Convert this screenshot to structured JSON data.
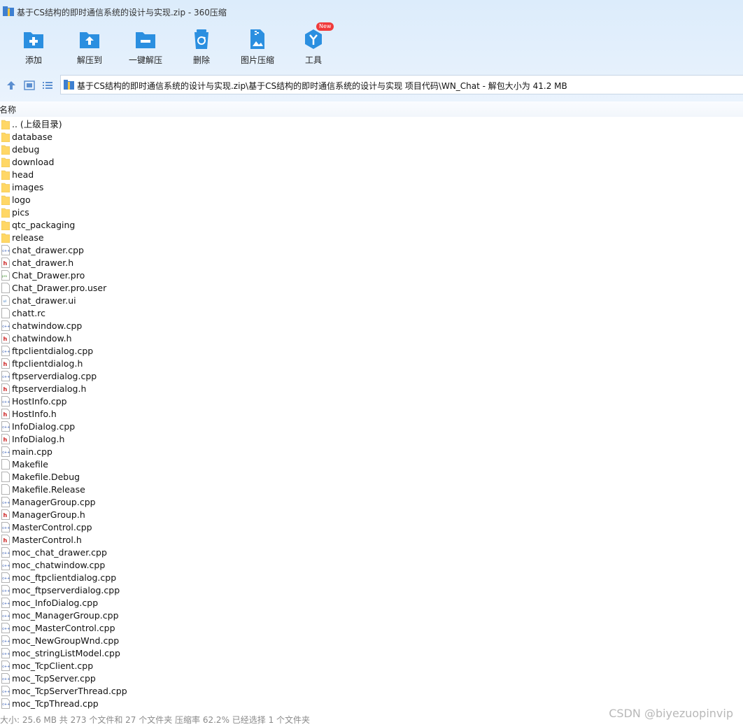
{
  "window": {
    "title": "基于CS结构的即时通信系统的设计与实现.zip - 360压缩"
  },
  "toolbar": {
    "buttons": [
      {
        "label": "添加",
        "icon": "add-icon"
      },
      {
        "label": "解压到",
        "icon": "extract-to-icon"
      },
      {
        "label": "一键解压",
        "icon": "one-click-extract-icon"
      },
      {
        "label": "删除",
        "icon": "delete-icon"
      },
      {
        "label": "图片压缩",
        "icon": "image-compress-icon"
      },
      {
        "label": "工具",
        "icon": "tools-icon",
        "badge": "New"
      }
    ]
  },
  "address": {
    "path": "基于CS结构的即时通信系统的设计与实现.zip\\基于CS结构的即时通信系统的设计与实现 项目代码\\WN_Chat - 解包大小为 41.2 MB"
  },
  "columns": {
    "name": "名称"
  },
  "files": [
    {
      "name": ".. (上级目录)",
      "type": "folder"
    },
    {
      "name": "database",
      "type": "folder"
    },
    {
      "name": "debug",
      "type": "folder"
    },
    {
      "name": "download",
      "type": "folder"
    },
    {
      "name": "head",
      "type": "folder"
    },
    {
      "name": "images",
      "type": "folder"
    },
    {
      "name": "logo",
      "type": "folder"
    },
    {
      "name": "pics",
      "type": "folder"
    },
    {
      "name": "qtc_packaging",
      "type": "folder"
    },
    {
      "name": "release",
      "type": "folder"
    },
    {
      "name": "chat_drawer.cpp",
      "type": "cpp"
    },
    {
      "name": "chat_drawer.h",
      "type": "h"
    },
    {
      "name": "Chat_Drawer.pro",
      "type": "pro"
    },
    {
      "name": "Chat_Drawer.pro.user",
      "type": "file"
    },
    {
      "name": "chat_drawer.ui",
      "type": "ui"
    },
    {
      "name": "chatt.rc",
      "type": "file"
    },
    {
      "name": "chatwindow.cpp",
      "type": "cpp"
    },
    {
      "name": "chatwindow.h",
      "type": "h"
    },
    {
      "name": "ftpclientdialog.cpp",
      "type": "cpp"
    },
    {
      "name": "ftpclientdialog.h",
      "type": "h"
    },
    {
      "name": "ftpserverdialog.cpp",
      "type": "cpp"
    },
    {
      "name": "ftpserverdialog.h",
      "type": "h"
    },
    {
      "name": "HostInfo.cpp",
      "type": "cpp"
    },
    {
      "name": "HostInfo.h",
      "type": "h"
    },
    {
      "name": "InfoDialog.cpp",
      "type": "cpp"
    },
    {
      "name": "InfoDialog.h",
      "type": "h"
    },
    {
      "name": "main.cpp",
      "type": "cpp"
    },
    {
      "name": "Makefile",
      "type": "file"
    },
    {
      "name": "Makefile.Debug",
      "type": "file"
    },
    {
      "name": "Makefile.Release",
      "type": "file"
    },
    {
      "name": "ManagerGroup.cpp",
      "type": "cpp"
    },
    {
      "name": "ManagerGroup.h",
      "type": "h"
    },
    {
      "name": "MasterControl.cpp",
      "type": "cpp"
    },
    {
      "name": "MasterControl.h",
      "type": "h"
    },
    {
      "name": "moc_chat_drawer.cpp",
      "type": "cpp"
    },
    {
      "name": "moc_chatwindow.cpp",
      "type": "cpp"
    },
    {
      "name": "moc_ftpclientdialog.cpp",
      "type": "cpp"
    },
    {
      "name": "moc_ftpserverdialog.cpp",
      "type": "cpp"
    },
    {
      "name": "moc_InfoDialog.cpp",
      "type": "cpp"
    },
    {
      "name": "moc_ManagerGroup.cpp",
      "type": "cpp"
    },
    {
      "name": "moc_MasterControl.cpp",
      "type": "cpp"
    },
    {
      "name": "moc_NewGroupWnd.cpp",
      "type": "cpp"
    },
    {
      "name": "moc_stringListModel.cpp",
      "type": "cpp"
    },
    {
      "name": "moc_TcpClient.cpp",
      "type": "cpp"
    },
    {
      "name": "moc_TcpServer.cpp",
      "type": "cpp"
    },
    {
      "name": "moc_TcpServerThread.cpp",
      "type": "cpp"
    },
    {
      "name": "moc_TcpThread.cpp",
      "type": "cpp"
    }
  ],
  "status": {
    "text": "大小: 25.6 MB 共 273 个文件和 27 个文件夹 压缩率 62.2% 已经选择 1 个文件夹"
  },
  "watermark": "CSDN @biyezuopinvip",
  "colors": {
    "toolbar_bg": "#dcecfb",
    "icon_blue": "#2b8fe0",
    "folder": "#ffd766",
    "badge": "#f03a3a"
  }
}
